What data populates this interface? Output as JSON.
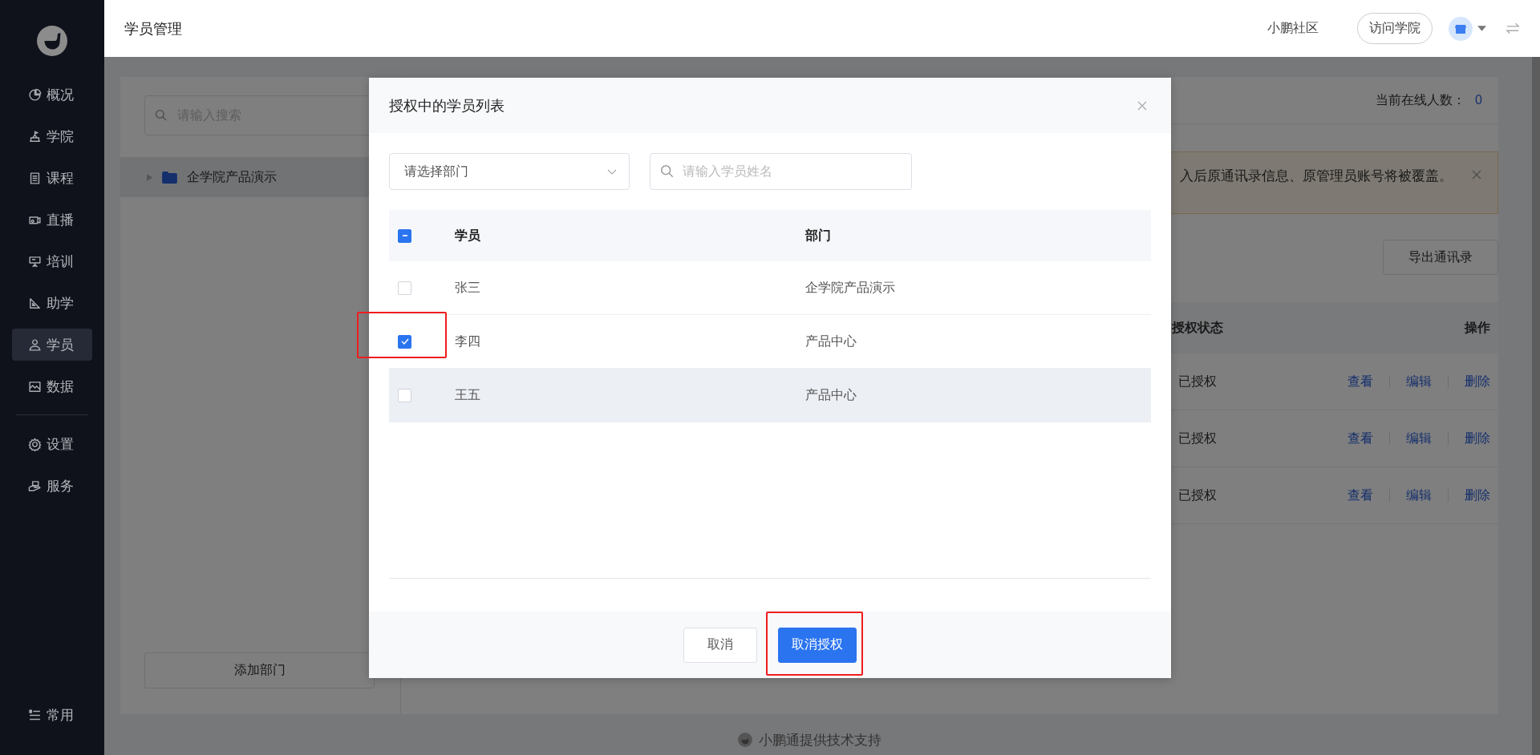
{
  "sidebar": {
    "groups": [
      [
        {
          "label": "概况",
          "selected": false
        },
        {
          "label": "学院",
          "selected": false
        },
        {
          "label": "课程",
          "selected": false
        },
        {
          "label": "直播",
          "selected": false
        },
        {
          "label": "培训",
          "selected": false
        },
        {
          "label": "助学",
          "selected": false
        },
        {
          "label": "学员",
          "selected": true
        },
        {
          "label": "数据",
          "selected": false
        }
      ],
      [
        {
          "label": "设置",
          "selected": false
        },
        {
          "label": "服务",
          "selected": false
        }
      ]
    ],
    "bottom_item": {
      "label": "常用"
    }
  },
  "header": {
    "title": "学员管理",
    "links": [
      {
        "label": "小鹏社区",
        "kind": "link"
      },
      {
        "label": "访问学院",
        "kind": "pill"
      }
    ]
  },
  "dept_panel": {
    "search": {
      "placeholder": "请输入搜索"
    },
    "tree": [
      {
        "label": "企学院产品演示",
        "expanded": false,
        "selected": true
      }
    ],
    "add_button": "添加部门"
  },
  "online": {
    "label": "当前在线人数：",
    "count": "0"
  },
  "alert": {
    "text": "入后原通讯录信息、原管理员账号将被覆盖。"
  },
  "export_button": "导出通讯录",
  "members_table": {
    "columns": [
      "授权状态",
      "操作"
    ],
    "rows": [
      {
        "status": "已授权",
        "actions": [
          "查看",
          "编辑",
          "删除"
        ]
      },
      {
        "status": "已授权",
        "actions": [
          "查看",
          "编辑",
          "删除"
        ]
      },
      {
        "status": "已授权",
        "actions": [
          "查看",
          "编辑",
          "删除"
        ]
      }
    ]
  },
  "footer": "小鹏通提供技术支持",
  "dialog": {
    "title": "授权中的学员列表",
    "department_select": {
      "placeholder": "请选择部门"
    },
    "name_search": {
      "placeholder": "请输入学员姓名"
    },
    "table": {
      "select_all": {
        "indeterminate": true
      },
      "columns": [
        "学员",
        "部门"
      ],
      "rows": [
        {
          "name": "张三",
          "department": "企学院产品演示",
          "checked": false,
          "hovered": false,
          "highlighted": false
        },
        {
          "name": "李四",
          "department": "产品中心",
          "checked": true,
          "hovered": false,
          "highlighted": true
        },
        {
          "name": "王五",
          "department": "产品中心",
          "checked": false,
          "hovered": true,
          "highlighted": false
        }
      ]
    },
    "buttons": [
      {
        "label": "取消",
        "kind": "default",
        "highlighted": false
      },
      {
        "label": "取消授权",
        "kind": "primary",
        "highlighted": true
      }
    ]
  }
}
